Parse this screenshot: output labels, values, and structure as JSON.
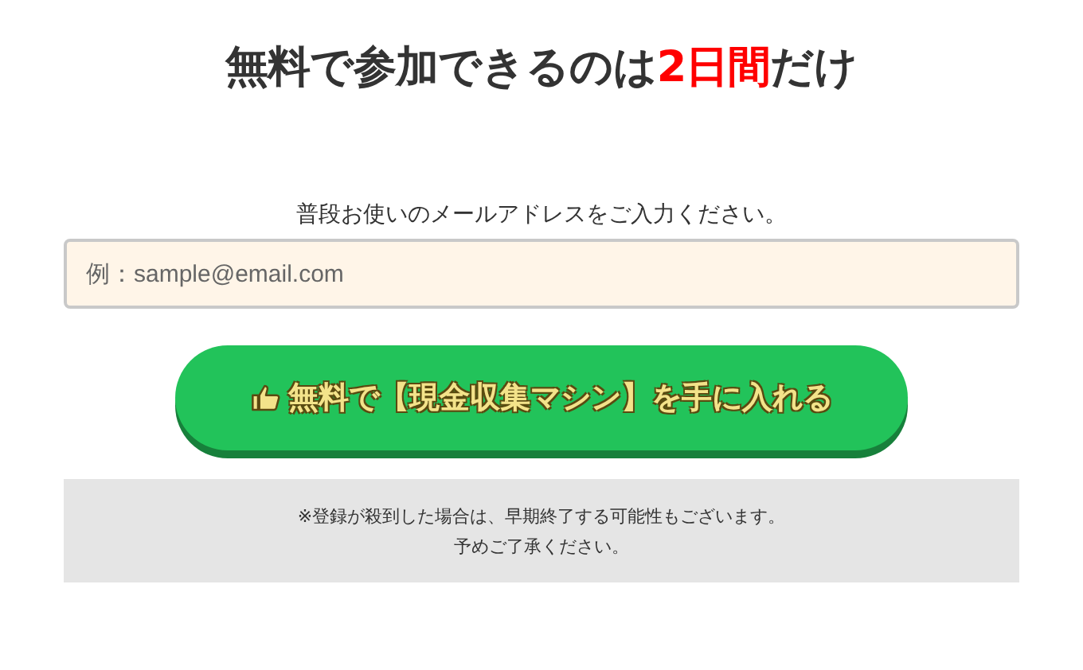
{
  "headline": {
    "before": "無料で参加できるのは",
    "highlight": "2日間",
    "after": "だけ"
  },
  "email_label": "普段お使いのメールアドレスをご入力ください。",
  "email_field": {
    "placeholder": "例：sample@email.com"
  },
  "submit_button": {
    "label": "無料で【現金収集マシン】を手に入れる"
  },
  "notice": [
    "※登録が殺到した場合は、早期終了する可能性もございます。",
    "予めご了承ください。"
  ]
}
